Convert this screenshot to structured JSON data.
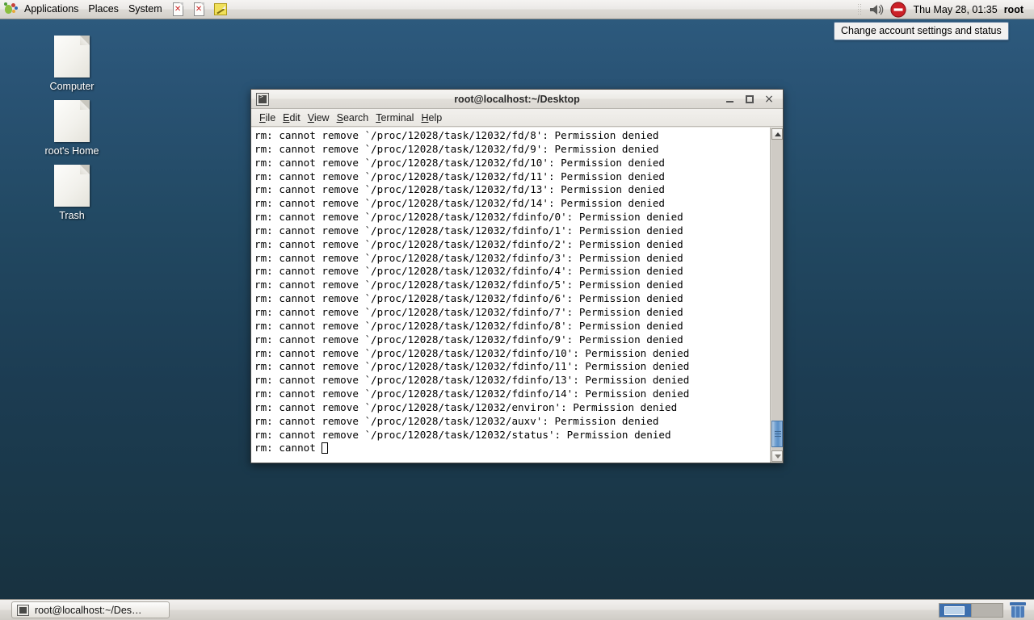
{
  "top_panel": {
    "menus": [
      "Applications",
      "Places",
      "System"
    ],
    "launchers": [
      {
        "name": "broken-document-launcher-1",
        "icon": "broken-document-icon"
      },
      {
        "name": "broken-document-launcher-2",
        "icon": "broken-document-icon"
      },
      {
        "name": "text-editor-launcher",
        "icon": "notepad-pencil-icon"
      }
    ],
    "volume_icon": "speaker-icon",
    "status_icon": "busy-status-icon",
    "clock": "Thu May 28, 01:35",
    "user": "root",
    "tooltip": "Change account settings and status"
  },
  "desktop": {
    "icons": [
      {
        "label": "Computer",
        "icon": "document-icon"
      },
      {
        "label": "root's Home",
        "icon": "document-icon"
      },
      {
        "label": "Trash",
        "icon": "document-icon"
      }
    ]
  },
  "terminal": {
    "title": "root@localhost:~/Desktop",
    "title_icon": "terminal-icon",
    "window_buttons": {
      "minimize": "_",
      "maximize": "□",
      "close": "×"
    },
    "menus": [
      {
        "label": "File",
        "mnemonic": "F"
      },
      {
        "label": "Edit",
        "mnemonic": "E"
      },
      {
        "label": "View",
        "mnemonic": "V"
      },
      {
        "label": "Search",
        "mnemonic": "S"
      },
      {
        "label": "Terminal",
        "mnemonic": "T"
      },
      {
        "label": "Help",
        "mnemonic": "H"
      }
    ],
    "lines": [
      "rm: cannot remove `/proc/12028/task/12032/fd/8': Permission denied",
      "rm: cannot remove `/proc/12028/task/12032/fd/9': Permission denied",
      "rm: cannot remove `/proc/12028/task/12032/fd/10': Permission denied",
      "rm: cannot remove `/proc/12028/task/12032/fd/11': Permission denied",
      "rm: cannot remove `/proc/12028/task/12032/fd/13': Permission denied",
      "rm: cannot remove `/proc/12028/task/12032/fd/14': Permission denied",
      "rm: cannot remove `/proc/12028/task/12032/fdinfo/0': Permission denied",
      "rm: cannot remove `/proc/12028/task/12032/fdinfo/1': Permission denied",
      "rm: cannot remove `/proc/12028/task/12032/fdinfo/2': Permission denied",
      "rm: cannot remove `/proc/12028/task/12032/fdinfo/3': Permission denied",
      "rm: cannot remove `/proc/12028/task/12032/fdinfo/4': Permission denied",
      "rm: cannot remove `/proc/12028/task/12032/fdinfo/5': Permission denied",
      "rm: cannot remove `/proc/12028/task/12032/fdinfo/6': Permission denied",
      "rm: cannot remove `/proc/12028/task/12032/fdinfo/7': Permission denied",
      "rm: cannot remove `/proc/12028/task/12032/fdinfo/8': Permission denied",
      "rm: cannot remove `/proc/12028/task/12032/fdinfo/9': Permission denied",
      "rm: cannot remove `/proc/12028/task/12032/fdinfo/10': Permission denied",
      "rm: cannot remove `/proc/12028/task/12032/fdinfo/11': Permission denied",
      "rm: cannot remove `/proc/12028/task/12032/fdinfo/13': Permission denied",
      "rm: cannot remove `/proc/12028/task/12032/fdinfo/14': Permission denied",
      "rm: cannot remove `/proc/12028/task/12032/environ': Permission denied",
      "rm: cannot remove `/proc/12028/task/12032/auxv': Permission denied",
      "rm: cannot remove `/proc/12028/task/12032/status': Permission denied"
    ],
    "prompt_partial": "rm: cannot "
  },
  "bottom_panel": {
    "task_button": {
      "label": "root@localhost:~/Des…",
      "icon": "terminal-icon"
    },
    "workspaces": [
      {
        "name": "workspace-1",
        "active": true
      },
      {
        "name": "workspace-2",
        "active": false
      }
    ],
    "trash_applet": "trash-icon"
  },
  "colors": {
    "desktop_top": "#2e5c80",
    "desktop_bottom": "#17303e",
    "panel": "#e7e5e1",
    "accent_blue": "#3d6fae",
    "terminal_bg": "#ffffff",
    "terminal_fg": "#000000"
  }
}
